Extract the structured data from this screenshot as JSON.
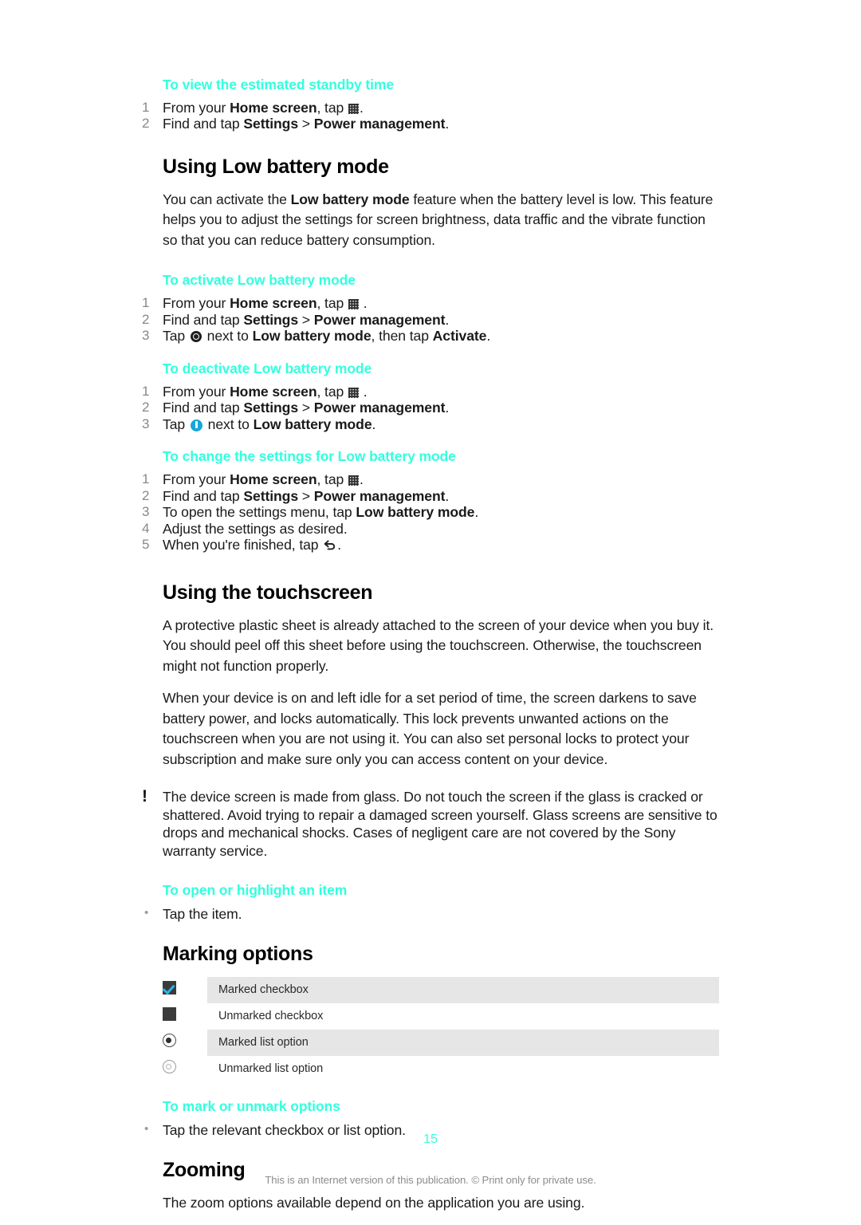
{
  "document": {
    "page_number": "15",
    "footer_note": "This is an Internet version of this publication. © Print only for private use.",
    "heading_color": "#33FFDD",
    "shaded_row_color": "#E6E6E6",
    "accent_blue": "#14A7D8"
  },
  "procedures": {
    "standby": {
      "title": "To view the estimated standby time",
      "steps": [
        {
          "pre": "From your ",
          "bold1": "Home screen",
          "mid": ", tap ",
          "icon": "app-drawer-grid-icon",
          "post": "."
        },
        {
          "pre": "Find and tap ",
          "bold1": "Settings",
          "mid": " > ",
          "bold2": "Power management",
          "post": "."
        }
      ]
    },
    "activate": {
      "title": "To activate Low battery mode",
      "steps": [
        {
          "pre": "From your ",
          "bold1": "Home screen",
          "mid": ", tap ",
          "icon": "app-drawer-grid-icon",
          "post": " ."
        },
        {
          "pre": "Find and tap ",
          "bold1": "Settings",
          "mid": " > ",
          "bold2": "Power management",
          "post": "."
        },
        {
          "pre": "Tap ",
          "icon": "power-ring-icon",
          "mid": " next to ",
          "bold1": "Low battery mode",
          "mid2": ", then tap ",
          "bold2": "Activate",
          "post": "."
        }
      ]
    },
    "deactivate": {
      "title": "To deactivate Low battery mode",
      "steps": [
        {
          "pre": "From your ",
          "bold1": "Home screen",
          "mid": ", tap ",
          "icon": "app-drawer-grid-icon",
          "post": " ."
        },
        {
          "pre": "Find and tap ",
          "bold1": "Settings",
          "mid": " > ",
          "bold2": "Power management",
          "post": "."
        },
        {
          "pre": "Tap ",
          "icon": "power-on-blue-icon",
          "mid": " next to ",
          "bold1": "Low battery mode",
          "post": "."
        }
      ]
    },
    "change_settings": {
      "title": "To change the settings for Low battery mode",
      "steps": [
        {
          "pre": "From your ",
          "bold1": "Home screen",
          "mid": ", tap ",
          "icon": "app-drawer-grid-icon",
          "post": "."
        },
        {
          "pre": "Find and tap ",
          "bold1": "Settings",
          "mid": " > ",
          "bold2": "Power management",
          "post": "."
        },
        {
          "pre": "To open the settings menu, tap ",
          "bold1": "Low battery mode",
          "post": "."
        },
        {
          "pre": "Adjust the settings as desired.",
          "post": ""
        },
        {
          "pre": "When you're finished, tap ",
          "icon": "back-arrow-icon",
          "post": "."
        }
      ]
    },
    "open_highlight": {
      "title": "To open or highlight an item",
      "bullets": [
        "Tap the item."
      ]
    },
    "mark_unmark": {
      "title": "To mark or unmark options",
      "bullets": [
        "Tap the relevant checkbox or list option."
      ]
    }
  },
  "sections": {
    "low_battery": {
      "title": "Using Low battery mode",
      "paragraph": {
        "pre": "You can activate the ",
        "bold": "Low battery mode",
        "post": " feature when the battery level is low. This feature helps you to adjust the settings for screen brightness, data traffic and the vibrate function so that you can reduce battery consumption."
      }
    },
    "touchscreen": {
      "title": "Using the touchscreen",
      "paragraphs": [
        "A protective plastic sheet is already attached to the screen of your device when you buy it. You should peel off this sheet before using the touchscreen. Otherwise, the touchscreen might not function properly.",
        "When your device is on and left idle for a set period of time, the screen darkens to save battery power, and locks automatically. This lock prevents unwanted actions on the touchscreen when you are not using it. You can also set personal locks to protect your subscription and make sure only you can access content on your device."
      ],
      "note": "The device screen is made from glass. Do not touch the screen if the glass is cracked or shattered. Avoid trying to repair a damaged screen yourself. Glass screens are sensitive to drops and mechanical shocks. Cases of negligent care are not covered by the Sony warranty service."
    },
    "marking_options": {
      "title": "Marking options",
      "rows": [
        {
          "glyph": "marked-checkbox-icon",
          "label": "Marked checkbox",
          "shaded": true
        },
        {
          "glyph": "unmarked-checkbox-icon",
          "label": "Unmarked checkbox",
          "shaded": false
        },
        {
          "glyph": "marked-radio-icon",
          "label": "Marked list option",
          "shaded": true
        },
        {
          "glyph": "unmarked-radio-icon",
          "label": "Unmarked list option",
          "shaded": false
        }
      ]
    },
    "zooming": {
      "title": "Zooming",
      "paragraph": "The zoom options available depend on the application you are using."
    }
  }
}
